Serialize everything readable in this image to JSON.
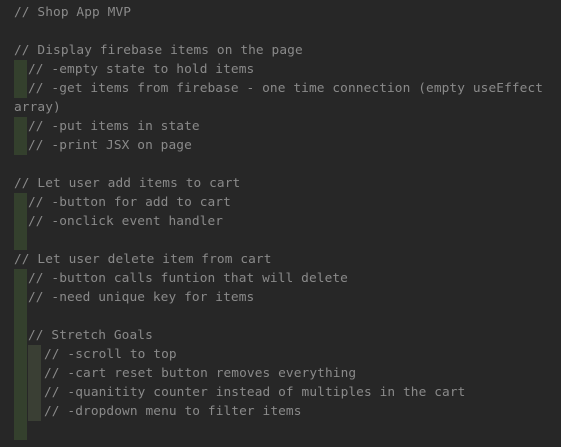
{
  "editor": {
    "lines": [
      {
        "text": "// Shop App MVP",
        "indent": 0
      },
      {
        "text": "",
        "indent": 0
      },
      {
        "text": "// Display firebase items on the page",
        "indent": 0
      },
      {
        "text": "// -empty state to hold items",
        "indent": 1
      },
      {
        "text": "// -get items from firebase - one time connection (empty useEffect",
        "indent": 1
      },
      {
        "text": "array)",
        "indent": 0
      },
      {
        "text": "// -put items in state",
        "indent": 1
      },
      {
        "text": "// -print JSX on page",
        "indent": 1
      },
      {
        "text": "",
        "indent": 0
      },
      {
        "text": "// Let user add items to cart",
        "indent": 0
      },
      {
        "text": "// -button for add to cart",
        "indent": 1
      },
      {
        "text": "// -onclick event handler",
        "indent": 1
      },
      {
        "text": "",
        "indent": 1
      },
      {
        "text": "// Let user delete item from cart",
        "indent": 0
      },
      {
        "text": "// -button calls funtion that will delete",
        "indent": 1
      },
      {
        "text": "// -need unique key for items",
        "indent": 1
      },
      {
        "text": "",
        "indent": 1
      },
      {
        "text": "// Stretch Goals",
        "indent": 1
      },
      {
        "text": "// -scroll to top",
        "indent": 2
      },
      {
        "text": "// -cart reset button removes everything",
        "indent": 2
      },
      {
        "text": "// -quanitity counter instead of multiples in the cart",
        "indent": 2
      },
      {
        "text": "// -dropdown menu to filter items",
        "indent": 2
      }
    ]
  },
  "colors": {
    "background": "#272727",
    "comment_text": "#8a8a8a",
    "indent_guide": "#34402d"
  }
}
